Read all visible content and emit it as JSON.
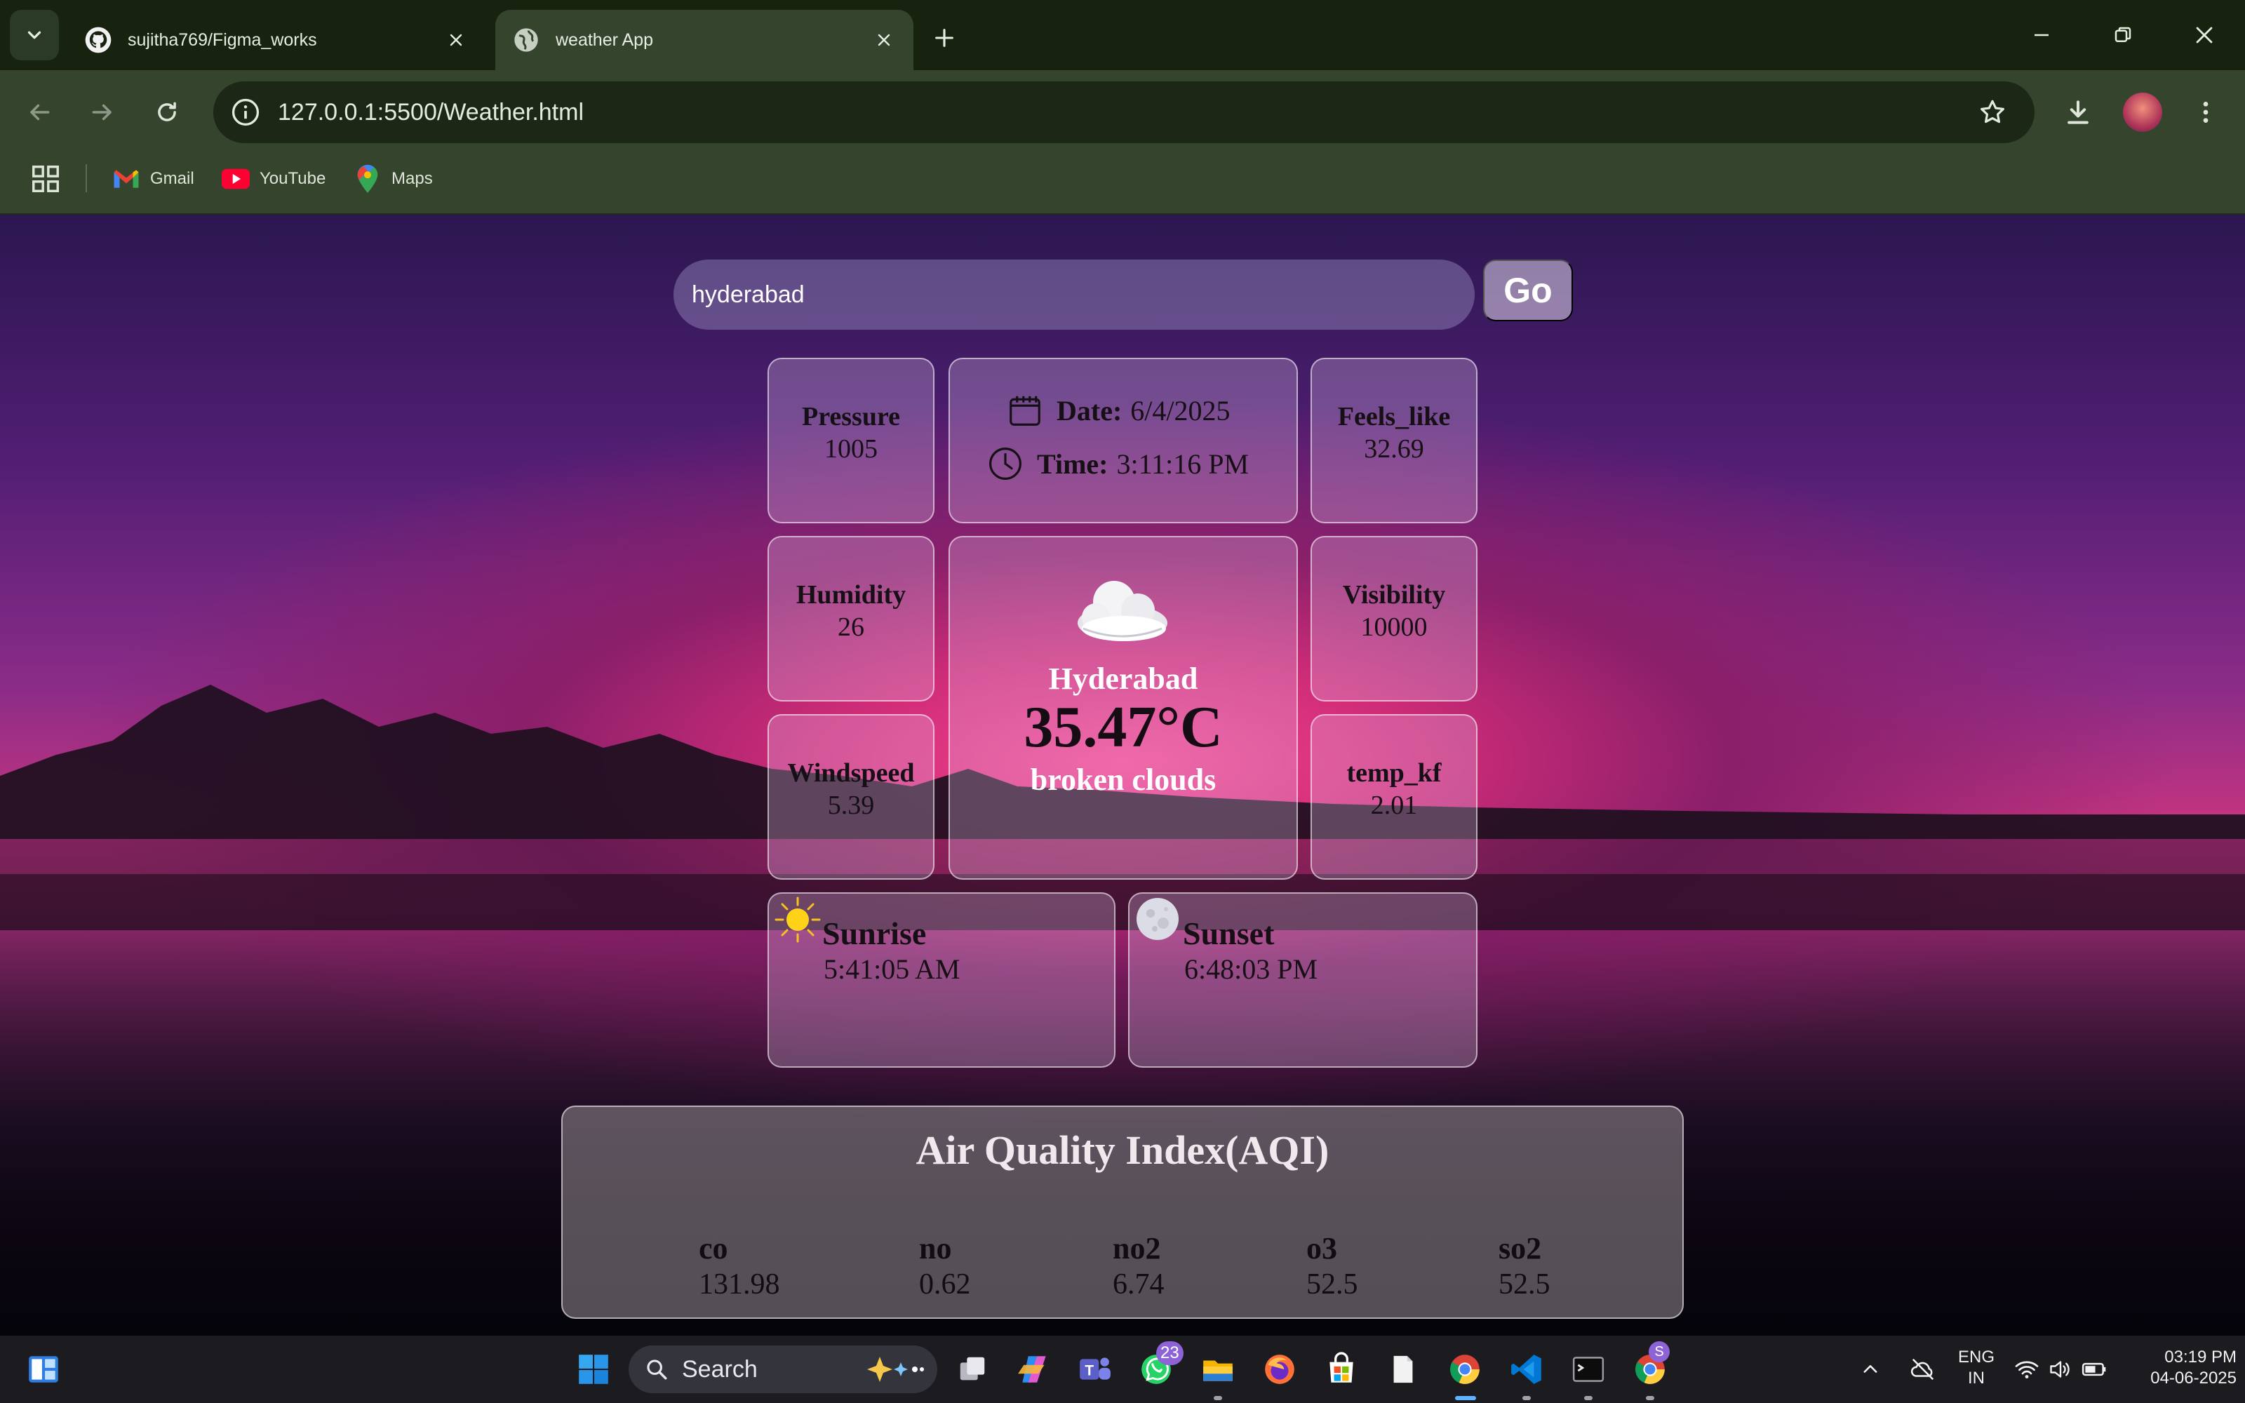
{
  "browser": {
    "tabs": [
      {
        "title": "sujitha769/Figma_works",
        "icon": "github-icon",
        "active": false
      },
      {
        "title": "weather App",
        "icon": "globe-icon",
        "active": true
      }
    ],
    "address_bar": {
      "url": "127.0.0.1:5500/Weather.html"
    },
    "bookmarks": [
      {
        "label": "Gmail",
        "icon": "gmail-icon"
      },
      {
        "label": "YouTube",
        "icon": "youtube-icon"
      },
      {
        "label": "Maps",
        "icon": "maps-icon"
      }
    ]
  },
  "weather": {
    "search": {
      "value": "hyderabad",
      "go_label": "Go"
    },
    "date_label": "Date:",
    "date_value": "6/4/2025",
    "time_label": "Time:",
    "time_value": "3:11:16 PM",
    "pressure": {
      "label": "Pressure",
      "value": "1005"
    },
    "feels_like": {
      "label": "Feels_like",
      "value": "32.69"
    },
    "humidity": {
      "label": "Humidity",
      "value": "26"
    },
    "visibility": {
      "label": "Visibility",
      "value": "10000"
    },
    "windspeed": {
      "label": "Windspeed",
      "value": "5.39"
    },
    "temp_kf": {
      "label": "temp_kf",
      "value": "2.01"
    },
    "main": {
      "city": "Hyderabad",
      "temperature": "35.47°C",
      "description": "broken clouds",
      "icon": "cloud-icon"
    },
    "sunrise": {
      "label": "Sunrise",
      "value": "5:41:05 AM",
      "icon": "sun-icon"
    },
    "sunset": {
      "label": "Sunset",
      "value": "6:48:03 PM",
      "icon": "moon-icon"
    },
    "aqi": {
      "title": "Air Quality Index(AQI)",
      "items": [
        {
          "label": "co",
          "value": "131.98"
        },
        {
          "label": "no",
          "value": "0.62"
        },
        {
          "label": "no2",
          "value": "6.74"
        },
        {
          "label": "o3",
          "value": "52.5"
        },
        {
          "label": "so2",
          "value": "52.5"
        }
      ]
    }
  },
  "taskbar": {
    "search_label": "Search",
    "whatsapp_badge": "23",
    "chrome_profile_badge": "S",
    "language": "ENG",
    "region": "IN",
    "time": "03:19 PM",
    "date": "04-06-2025"
  },
  "colors": {
    "chrome_dark": "#17230f",
    "chrome_toolbar": "#34442d",
    "sky_pink": "#f4448f",
    "sky_purple": "#521e74",
    "taskbar": "#1b1b20"
  }
}
